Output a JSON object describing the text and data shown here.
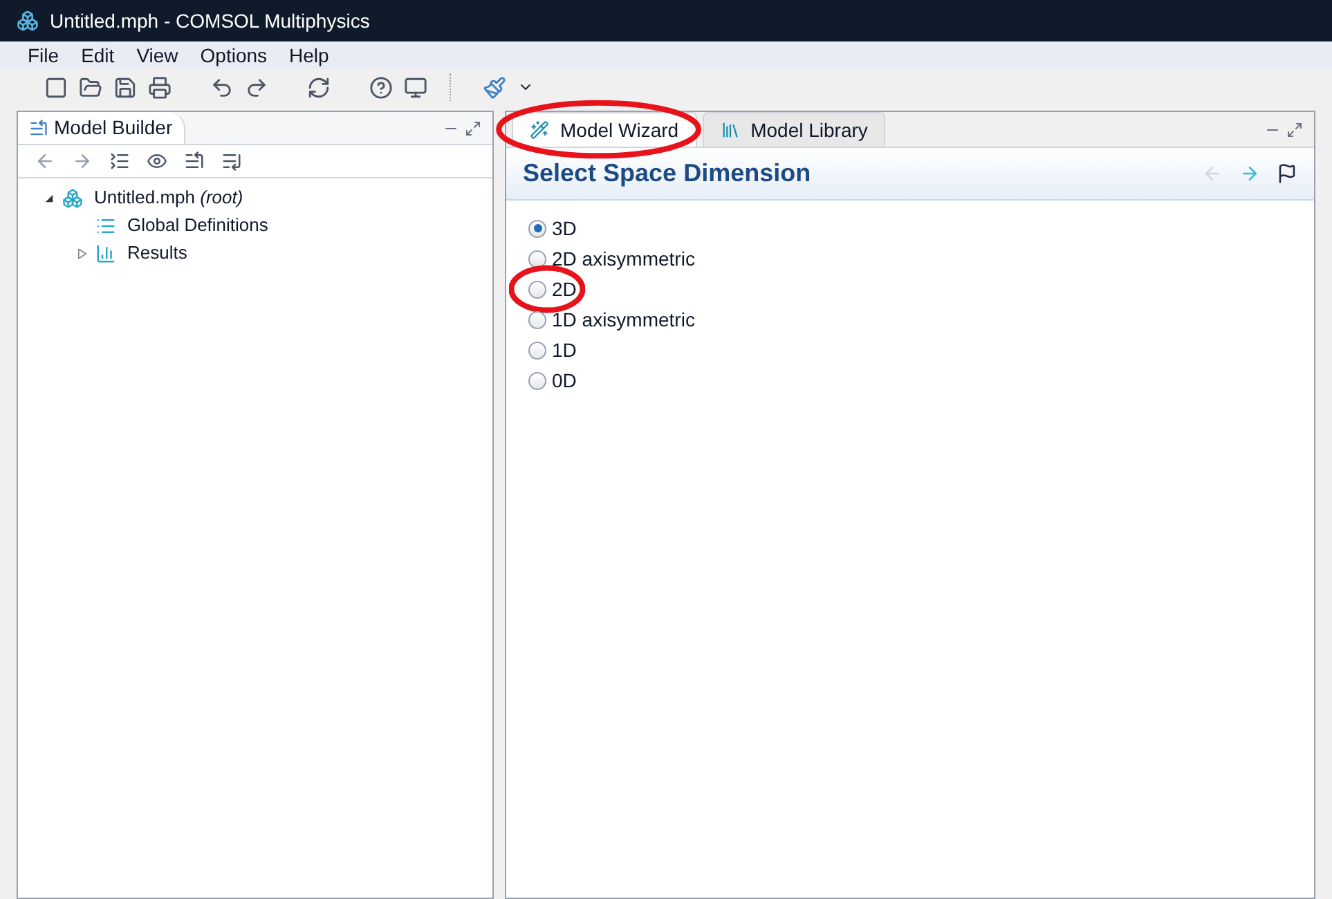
{
  "window": {
    "title": "Untitled.mph - COMSOL Multiphysics"
  },
  "menu": [
    "File",
    "Edit",
    "View",
    "Options",
    "Help"
  ],
  "left_panel": {
    "tab": {
      "label": "Model Builder",
      "selected": true
    },
    "tree": [
      {
        "label": "Untitled.mph",
        "suffix": "(root)",
        "expanded": true,
        "children": [
          {
            "label": "Global Definitions",
            "kind": "definitions"
          },
          {
            "label": "Results",
            "kind": "results",
            "expanded": false
          }
        ]
      }
    ]
  },
  "right_panel": {
    "tabs": [
      {
        "label": "Model Wizard",
        "selected": true,
        "circled": true,
        "kind": "wizard"
      },
      {
        "label": "Model Library",
        "selected": false,
        "circled": false,
        "kind": "library"
      }
    ],
    "heading": "Select Space Dimension",
    "options": [
      {
        "label": "3D",
        "selected": true,
        "circled": false
      },
      {
        "label": "2D axisymmetric",
        "selected": false,
        "circled": false
      },
      {
        "label": "2D",
        "selected": false,
        "circled": true
      },
      {
        "label": "1D axisymmetric",
        "selected": false,
        "circled": false
      },
      {
        "label": "1D",
        "selected": false,
        "circled": false
      },
      {
        "label": "0D",
        "selected": false,
        "circled": false
      }
    ]
  }
}
